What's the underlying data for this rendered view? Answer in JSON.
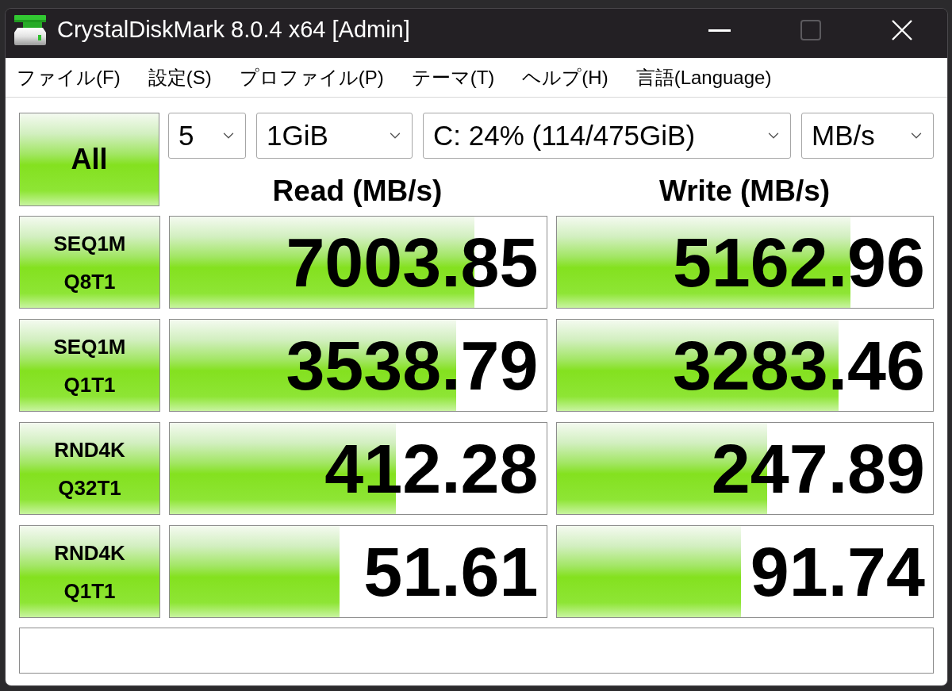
{
  "window": {
    "title": "CrystalDiskMark 8.0.4 x64 [Admin]",
    "controls": [
      {
        "kind": "minimize",
        "disabled": false
      },
      {
        "kind": "maximize",
        "disabled": true
      },
      {
        "kind": "close",
        "disabled": false
      }
    ]
  },
  "menu": [
    {
      "label": "ファイル(F)"
    },
    {
      "label": "設定(S)"
    },
    {
      "label": "プロファイル(P)"
    },
    {
      "label": "テーマ(T)"
    },
    {
      "label": "ヘルプ(H)"
    },
    {
      "label": "言語(Language)"
    }
  ],
  "all_button": {
    "label": "All"
  },
  "dropdowns": [
    {
      "value": "5"
    },
    {
      "value": "1GiB"
    },
    {
      "value": "C: 24% (114/475GiB)"
    },
    {
      "value": "MB/s"
    }
  ],
  "columns": [
    "Read (MB/s)",
    "Write (MB/s)"
  ],
  "tests": [
    {
      "label": [
        "SEQ1M",
        "Q8T1"
      ],
      "read": {
        "value": "7003.85",
        "level": 0.81
      },
      "write": {
        "value": "5162.96",
        "level": 0.78
      }
    },
    {
      "label": [
        "SEQ1M",
        "Q1T1"
      ],
      "read": {
        "value": "3538.79",
        "level": 0.76
      },
      "write": {
        "value": "3283.46",
        "level": 0.75
      }
    },
    {
      "label": [
        "RND4K",
        "Q32T1"
      ],
      "read": {
        "value": "412.28",
        "level": 0.6
      },
      "write": {
        "value": "247.89",
        "level": 0.56
      }
    },
    {
      "label": [
        "RND4K",
        "Q1T1"
      ],
      "read": {
        "value": "51.61",
        "level": 0.45
      },
      "write": {
        "value": "91.74",
        "level": 0.49
      }
    }
  ]
}
